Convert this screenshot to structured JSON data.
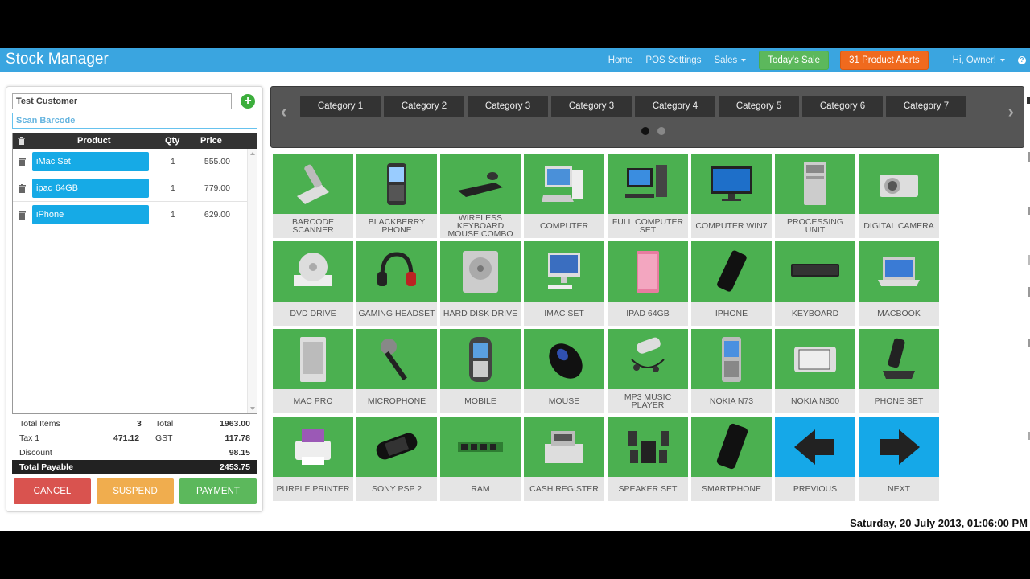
{
  "app": {
    "title": "Stock Manager"
  },
  "nav": {
    "home": "Home",
    "pos_settings": "POS Settings",
    "sales": "Sales",
    "todays_sale": "Today's Sale",
    "product_alerts": "31 Product Alerts",
    "user": "Hi, Owner!"
  },
  "customer": {
    "value": "Test Customer",
    "scan_placeholder": "Scan Barcode"
  },
  "table": {
    "headers": {
      "product": "Product",
      "qty": "Qty",
      "price": "Price"
    },
    "rows": [
      {
        "name": "iMac Set",
        "qty": "1",
        "price": "555.00"
      },
      {
        "name": "ipad 64GB",
        "qty": "1",
        "price": "779.00"
      },
      {
        "name": "iPhone",
        "qty": "1",
        "price": "629.00"
      }
    ]
  },
  "totals": {
    "total_items_label": "Total Items",
    "total_items": "3",
    "total_label": "Total",
    "total": "1963.00",
    "tax_label": "Tax 1",
    "tax": "471.12",
    "gst_label": "GST",
    "gst": "117.78",
    "discount_label": "Discount",
    "discount": "98.15",
    "payable_label": "Total Payable",
    "payable": "2453.75"
  },
  "actions": {
    "cancel": "CANCEL",
    "suspend": "SUSPEND",
    "payment": "PAYMENT"
  },
  "categories": [
    "Category 1",
    "Category 2",
    "Category 3",
    "Category 3",
    "Category 4",
    "Category 5",
    "Category 6",
    "Category 7"
  ],
  "products": [
    {
      "name": "BARCODE SCANNER",
      "icon": "barcode-scanner-icon"
    },
    {
      "name": "BLACKBERRY PHONE",
      "icon": "blackberry-phone-icon"
    },
    {
      "name": "WIRELESS KEYBOARD MOUSE COMBO",
      "icon": "keyboard-mouse-icon"
    },
    {
      "name": "COMPUTER",
      "icon": "computer-icon"
    },
    {
      "name": "FULL COMPUTER SET",
      "icon": "computer-set-icon"
    },
    {
      "name": "COMPUTER WIN7",
      "icon": "monitor-icon"
    },
    {
      "name": "PROCESSING UNIT",
      "icon": "tower-icon"
    },
    {
      "name": "DIGITAL CAMERA",
      "icon": "camera-icon"
    },
    {
      "name": "DVD DRIVE",
      "icon": "dvd-drive-icon"
    },
    {
      "name": "GAMING HEADSET",
      "icon": "headset-icon"
    },
    {
      "name": "HARD DISK DRIVE",
      "icon": "hard-disk-icon"
    },
    {
      "name": "IMAC SET",
      "icon": "imac-icon"
    },
    {
      "name": "IPAD 64GB",
      "icon": "tablet-icon"
    },
    {
      "name": "IPHONE",
      "icon": "phone-icon"
    },
    {
      "name": "KEYBOARD",
      "icon": "keyboard-icon"
    },
    {
      "name": "MACBOOK",
      "icon": "laptop-icon"
    },
    {
      "name": "MAC PRO",
      "icon": "mac-pro-icon"
    },
    {
      "name": "MICROPHONE",
      "icon": "microphone-icon"
    },
    {
      "name": "MOBILE",
      "icon": "mobile-icon"
    },
    {
      "name": "MOUSE",
      "icon": "mouse-icon"
    },
    {
      "name": "MP3 MUSIC PLAYER",
      "icon": "mp3-player-icon"
    },
    {
      "name": "NOKIA N73",
      "icon": "nokia-phone-icon"
    },
    {
      "name": "NOKIA N800",
      "icon": "nokia-tablet-icon"
    },
    {
      "name": "PHONE SET",
      "icon": "desk-phone-icon"
    },
    {
      "name": "PURPLE PRINTER",
      "icon": "printer-icon"
    },
    {
      "name": "SONY PSP 2",
      "icon": "psp-icon"
    },
    {
      "name": "RAM",
      "icon": "ram-icon"
    },
    {
      "name": "CASH REGISTER",
      "icon": "cash-register-icon"
    },
    {
      "name": "SPEAKER SET",
      "icon": "speaker-icon"
    },
    {
      "name": "SMARTPHONE",
      "icon": "smartphone-icon"
    }
  ],
  "pager": {
    "previous": "PREVIOUS",
    "next": "NEXT"
  },
  "datetime": "Saturday, 20 July 2013, 01:06:00 PM",
  "colors": {
    "navbar": "#3aa5e0",
    "tile_green": "#4bb050",
    "tile_blue": "#15a8e8",
    "row_blue": "#16aae6",
    "alert_orange": "#f06a1e"
  }
}
